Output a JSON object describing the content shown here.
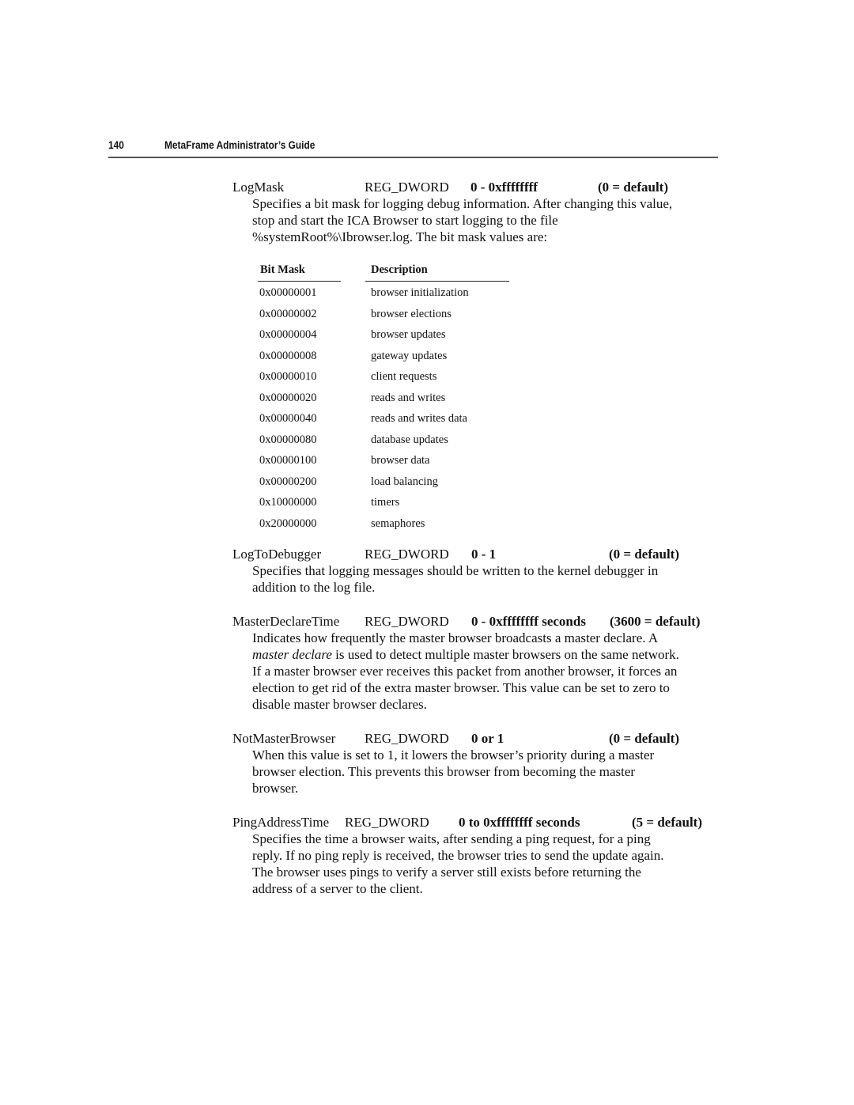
{
  "header": {
    "page_number": "140",
    "title": "MetaFrame Administrator’s Guide"
  },
  "entries": [
    {
      "name": "LogMask",
      "type": "REG_DWORD",
      "range": "0 - 0xffffffff",
      "default": "(0 = default)",
      "lines": [
        "Specifies a bit mask for logging debug information.  After changing this value,",
        "stop and start the ICA Browser to start logging to the file",
        "%systemRoot%\\Ibrowser.log. The bit mask values are:"
      ]
    },
    {
      "name": "LogToDebugger",
      "type": "REG_DWORD",
      "range": "0 - 1",
      "default": "(0 = default)",
      "lines": [
        "Specifies that logging messages should be written to the kernel debugger in",
        "addition to the log file."
      ]
    },
    {
      "name": "MasterDeclareTime",
      "type": "REG_DWORD",
      "range": "0 - 0xffffffff seconds",
      "default": "(3600 = default)",
      "lines": [
        "Indicates how frequently the master browser broadcasts a master declare. A",
        "is used to detect multiple master browsers on the same network.",
        "If a master browser ever receives this packet from another browser, it forces an",
        "election to get rid of the extra master browser. This value can be set to zero to",
        "disable master browser declares."
      ],
      "italic_term": "master declare"
    },
    {
      "name": "NotMasterBrowser",
      "type": "REG_DWORD",
      "range": "0 or 1",
      "default": "(0 = default)",
      "lines": [
        "When this value is set to 1, it lowers the browser’s priority during a master",
        "browser election. This prevents this browser from becoming the master",
        "browser."
      ]
    },
    {
      "name": "PingAddressTime",
      "type": "REG_DWORD",
      "range": "0 to 0xffffffff seconds",
      "default": "(5 = default)",
      "lines": [
        "Specifies the time a browser waits, after sending a ping request, for a ping",
        "reply.  If no ping reply is received, the browser tries to send the update again.",
        "The browser uses pings to verify a server still exists before returning the",
        "address of a server to the client."
      ]
    }
  ],
  "bitmask_table": {
    "headers": [
      "Bit Mask",
      "Description"
    ],
    "rows": [
      {
        "mask": "0x00000001",
        "description": "browser initialization"
      },
      {
        "mask": "0x00000002",
        "description": "browser elections"
      },
      {
        "mask": "0x00000004",
        "description": "browser updates"
      },
      {
        "mask": "0x00000008",
        "description": "gateway updates"
      },
      {
        "mask": "0x00000010",
        "description": "client requests"
      },
      {
        "mask": "0x00000020",
        "description": "reads and writes"
      },
      {
        "mask": "0x00000040",
        "description": "reads and writes data"
      },
      {
        "mask": "0x00000080",
        "description": "database updates"
      },
      {
        "mask": "0x00000100",
        "description": "browser data"
      },
      {
        "mask": "0x00000200",
        "description": "load balancing"
      },
      {
        "mask": "0x10000000",
        "description": "timers"
      },
      {
        "mask": "0x20000000",
        "description": "semaphores"
      }
    ]
  }
}
